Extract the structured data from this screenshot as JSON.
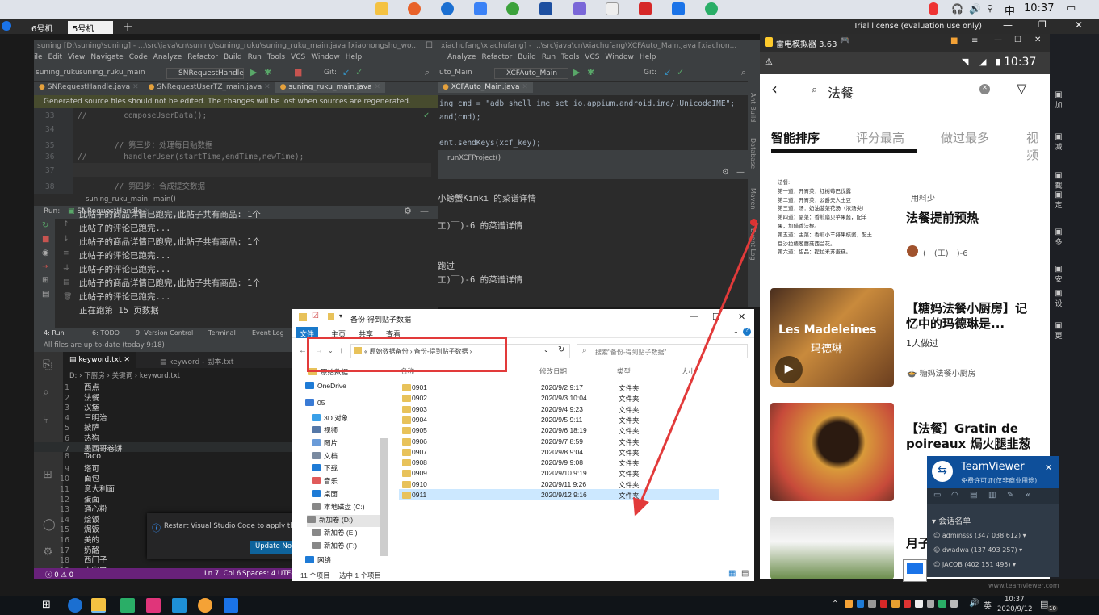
{
  "teamdesk": {
    "tabs": [
      "6号机",
      "5号机"
    ],
    "trial": "Trial license (evaluation use only)",
    "time": "10:37",
    "ime": "中"
  },
  "idea_left": {
    "title": "suning [D:\\suning\\suning] - ...\\src\\java\\cn\\suning\\suning_ruku\\suning_ruku_main.java [xiaohongshu_wo...",
    "menus": [
      "ile",
      "Edit",
      "View",
      "Navigate",
      "Code",
      "Analyze",
      "Refactor",
      "Build",
      "Run",
      "Tools",
      "VCS",
      "Window",
      "Help"
    ],
    "crumb1": "suning_ruku",
    "crumb2": "suning_ruku_main",
    "runconfig": "SNRequestHandle",
    "git": "Git:",
    "tabs": [
      "SNRequestHandle.java",
      "SNRequestUserTZ_main.java",
      "suning_ruku_main.java"
    ],
    "banner": "Generated source files should not be edited. The changes will be lost when sources are regenerated.",
    "lines": [
      {
        "n": "33",
        "t": "//        composeUserData();"
      },
      {
        "n": "34",
        "t": ""
      },
      {
        "n": "35",
        "t": "        // 第三步：处理每日贴数据"
      },
      {
        "n": "36",
        "t": "//        handlerUser(startTime,endTime,newTime);"
      },
      {
        "n": "37",
        "t": ""
      },
      {
        "n": "38",
        "t": "        // 第四步：合成提交数据"
      }
    ],
    "breadcrumb": [
      "suning_ruku_main",
      "main()"
    ],
    "run_label": "Run:",
    "run_tab": "SNRequestHandle",
    "run_output": [
      "此帖子的商品详情已跑完,此帖子共有商品: 1个",
      "此帖子的评论已跑完...",
      "此帖子的商品详情已跑完,此帖子共有商品: 1个",
      "此帖子的评论已跑完...",
      "此帖子的评论已跑完...",
      "此帖子的商品详情已跑完,此帖子共有商品: 1个",
      "此帖子的评论已跑完...",
      "正在跑第 15 页数据"
    ],
    "bottom_tabs": [
      "4: Run",
      "6: TODO",
      "9: Version Control",
      "Terminal",
      "Event Log"
    ],
    "status": "All files are up-to-date (today 9:18)"
  },
  "idea_right": {
    "title": "xiachufang\\xiachufang] - ...\\src\\java\\cn\\xiachufang\\XCFAuto_Main.java [xiachon...",
    "menus": [
      "Analyze",
      "Refactor",
      "Build",
      "Run",
      "Tools",
      "VCS",
      "Window",
      "Help"
    ],
    "crumb": "uto_Main",
    "runconfig": "XCFAuto_Main",
    "git": "Git:",
    "tab": "XCFAuto_Main.java",
    "code1": "ing cmd = \"adb shell ime set io.appium.android.ime/.UnicodeIME\";",
    "code2": "and(cmd);",
    "code3": "ent.sendKeys(xcf_key);",
    "code4": "runXCFProject()",
    "output": [
      "小螃蟹Kimki 的菜谱详情",
      "工)￣)-6 的菜谱详情",
      "跑过",
      "工)￣)-6 的菜谱详情"
    ],
    "side_tabs": [
      "Ant Build",
      "Database",
      "Maven",
      "Event Log"
    ]
  },
  "vscode": {
    "tabs": [
      "keyword.txt",
      "keyword - 副本.txt"
    ],
    "path": [
      "D:",
      "下厨房",
      "关键词",
      "keyword.txt"
    ],
    "lines": [
      "西点",
      "法餐",
      "汉堡",
      "三明治",
      "披萨",
      "热狗",
      "墨西哥卷饼",
      "Taco",
      "塔可",
      "面包",
      "意大利面",
      "蛋面",
      "通心粉",
      "烩饭",
      "焗饭",
      "美的",
      "奶酪",
      "西门子",
      "小家电"
    ],
    "notice": "Restart Visual Studio Code to apply the lat",
    "update": "Update Now",
    "status": {
      "errors": "0",
      "warnings": "0",
      "pos": "Ln 7, Col 6",
      "spaces": "Spaces: 4",
      "enc": "UTF-"
    }
  },
  "explorer": {
    "title": "备份-得到贴子数据",
    "ribbon": [
      "文件",
      "主页",
      "共享",
      "查看"
    ],
    "address": [
      "原始数据备份",
      "备份-得到贴子数据"
    ],
    "search": "搜索\"备份-得到贴子数据\"",
    "cols": [
      "名称",
      "修改日期",
      "类型",
      "大小"
    ],
    "nav": [
      "原始数据",
      "OneDrive",
      "05",
      "3D 对象",
      "视频",
      "图片",
      "文档",
      "下载",
      "音乐",
      "桌面",
      "本地磁盘 (C:)",
      "新加卷 (D:)",
      "新加卷 (E:)",
      "新加卷 (F:)",
      "网络"
    ],
    "rows": [
      {
        "name": "0901",
        "date": "2020/9/2 9:17",
        "type": "文件夹"
      },
      {
        "name": "0902",
        "date": "2020/9/3 10:04",
        "type": "文件夹"
      },
      {
        "name": "0903",
        "date": "2020/9/4 9:23",
        "type": "文件夹"
      },
      {
        "name": "0904",
        "date": "2020/9/5 9:11",
        "type": "文件夹"
      },
      {
        "name": "0905",
        "date": "2020/9/6 18:19",
        "type": "文件夹"
      },
      {
        "name": "0906",
        "date": "2020/9/7 8:59",
        "type": "文件夹"
      },
      {
        "name": "0907",
        "date": "2020/9/8 9:04",
        "type": "文件夹"
      },
      {
        "name": "0908",
        "date": "2020/9/9 9:08",
        "type": "文件夹"
      },
      {
        "name": "0909",
        "date": "2020/9/10 9:19",
        "type": "文件夹"
      },
      {
        "name": "0910",
        "date": "2020/9/11 9:26",
        "type": "文件夹"
      },
      {
        "name": "0911",
        "date": "2020/9/12 9:16",
        "type": "文件夹"
      }
    ],
    "status_left": "11 个项目",
    "status_right": "选中 1 个项目"
  },
  "leidian": {
    "title": "雷电模拟器 3.63",
    "time": "10:37",
    "search": "法餐",
    "tabs": [
      "智能排序",
      "评分最高",
      "做过最多",
      "视频"
    ],
    "cards": [
      {
        "title": "法餐提前预热",
        "top": "用料少",
        "author": "(￣(工)￣)-6",
        "sub": ""
      },
      {
        "title": "【糖妈法餐小厨房】记忆中的玛德琳是...",
        "top": "",
        "sub": "1人做过",
        "author": "糖妈法餐小厨房"
      },
      {
        "title": "【法餐】Gratin de poireaux 焗火腿韭葱",
        "top": "",
        "sub": "",
        "author": ""
      },
      {
        "title": "月子",
        "top": "",
        "sub": "",
        "author": ""
      }
    ],
    "recipe_text": [
      "法餐:",
      "第一道：开胃菜：红树莓巴伐露",
      "第二道：开胃菜：公爵夫人土豆",
      "第三道：汤：奶油菠菜花汤（浓汤类）",
      "第四道：副菜：香煎扇贝苹果酱，配羊",
      "果，加醋香法棍。",
      "第五道：主菜：香煎小羊排果核酱，配土",
      "豆沙拉楂葱蘑菇西兰花。",
      "第六道：甜品：提拉米苏蛋糕。"
    ],
    "madeleine": [
      "Les Madeleines",
      "玛德琳"
    ],
    "side": [
      "加",
      "减",
      "截",
      "定",
      "多",
      "安",
      "设",
      "更"
    ]
  },
  "teamviewer": {
    "title": "TeamViewer",
    "sub": "免费许可证(仅非商业用途)",
    "list_title": "会话名单",
    "users": [
      "adminsss (347 038 612)",
      "dwadwa (137 493 257)",
      "JACOB (402 151 495)"
    ],
    "url": "www.teamviewer.com"
  },
  "taskbar": {
    "time": "10:37",
    "date": "2020/9/12",
    "ime": "英",
    "badge": "10"
  },
  "colors": {
    "annotation": "#e23a3a",
    "accent": "#0078d7",
    "vs_status": "#68217a"
  }
}
